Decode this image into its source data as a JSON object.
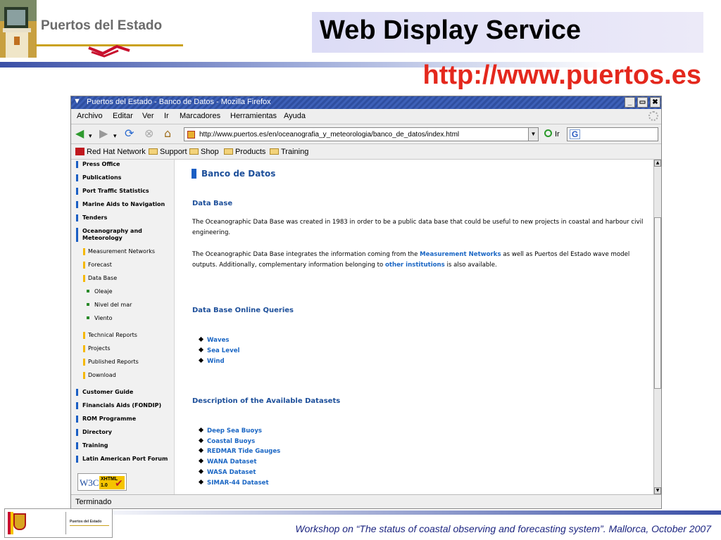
{
  "slide": {
    "brand": "Puertos del Estado",
    "title": "Web Display Service",
    "url": "http://www.puertos.es",
    "footer": "Workshop on “The status of coastal observing and forecasting system”. Mallorca, October 2007"
  },
  "browser": {
    "window_title": "Puertos del Estado - Banco de Datos - Mozilla Firefox",
    "menu": [
      "Archivo",
      "Editar",
      "Ver",
      "Ir",
      "Marcadores",
      "Herramientas",
      "Ayuda"
    ],
    "address": "http://www.puertos.es/en/oceanografia_y_meteorologia/banco_de_datos/index.html",
    "go_label": "Ir",
    "bookmarks": [
      "Red Hat Network",
      "Support",
      "Shop",
      "Products",
      "Training"
    ],
    "status": "Terminado"
  },
  "sidebar": {
    "top_items": [
      "Press Office",
      "Publications",
      "Port Traffic Statistics",
      "Marine Aids to Navigation",
      "Tenders"
    ],
    "ocean_item": [
      "Oceanography and",
      "Meteorology"
    ],
    "sub_items": [
      "Measurement Networks",
      "Forecast",
      "Data Base"
    ],
    "sub_sub_items": [
      "Oleaje",
      "Nivel del mar",
      "Viento"
    ],
    "sub_items_2": [
      "Technical Reports",
      "Projects",
      "Published Reports",
      "Download"
    ],
    "bottom_items": [
      "Customer Guide",
      "Financials Aids (FONDIP)",
      "ROM Programme",
      "Directory",
      "Training",
      "Latin American Port Forum"
    ],
    "badge_w3c": "W3C",
    "badge_xhtml": [
      "XHTML",
      "1.0"
    ]
  },
  "main": {
    "heading": "Banco de Datos",
    "section1_title": "Data Base",
    "para1": "The Oceanographic Data Base was created in 1983 in order to be a public data base that could be useful to new projects in coastal and harbour civil engineering.",
    "para2_a": "The Oceanographic Data Base  integrates the information coming from the ",
    "para2_link1": "Measurement Networks",
    "para2_b": " as well as  Puertos del Estado wave model outputs. Additionally, complementary information belonging to ",
    "para2_link2": "other institutions",
    "para2_c": " is also available.",
    "section2_title": "Data Base Online Queries",
    "queries": [
      "Waves",
      "Sea Level",
      "Wind"
    ],
    "section3_title": "Description of the Available Datasets",
    "datasets": [
      "Deep Sea Buoys",
      "Coastal Buoys",
      "REDMAR Tide Gauges",
      "WANA Dataset",
      "WASA Dataset",
      "SIMAR-44 Dataset"
    ]
  }
}
